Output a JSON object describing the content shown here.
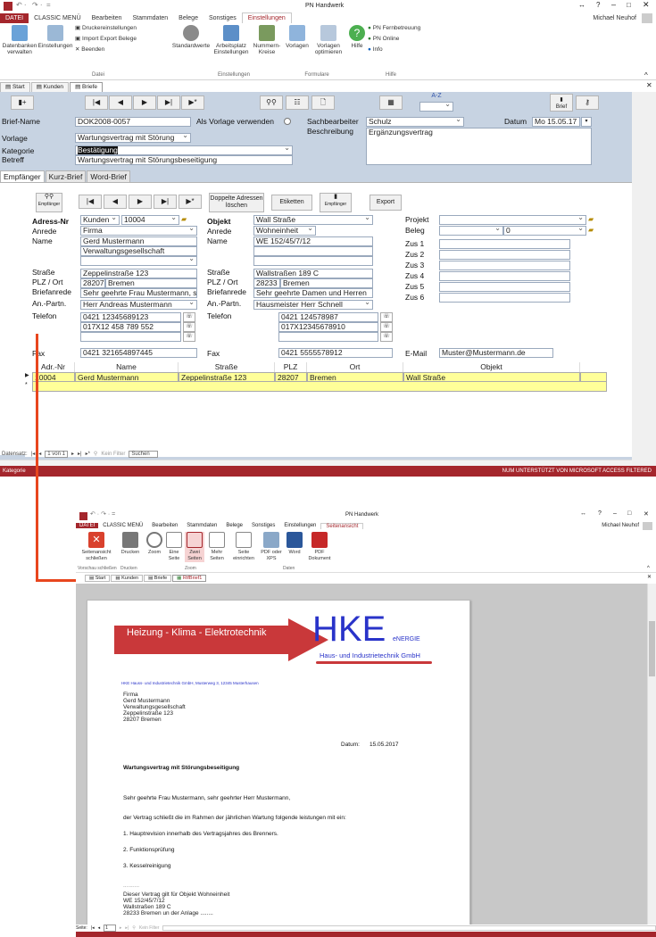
{
  "win1": {
    "title": "PN Handwerk",
    "user": "Michael Neuhof",
    "menu": [
      "DATEI",
      "CLASSIC MENÜ",
      "Bearbeiten",
      "Stammdaten",
      "Belege",
      "Sonstiges",
      "Einstellungen"
    ],
    "ribbon": {
      "datenbanken": "Datenbanken verwalten",
      "einstellungen": "Einstellungen",
      "druckereinstellungen": "Druckereinstellungen",
      "import_export": "Import Export Belege",
      "beenden": "Beenden",
      "standardwerte": "Standardwerte",
      "arbeitsplatz": "Arbeitsplatz Einstellungen",
      "nummernkreise": "Nummern- Kreise",
      "vorlagen": "Vorlagen",
      "vorlagen_opt": "Vorlagen optimieren",
      "hilfe": "Hilfe",
      "fernbetreuung": "PN Fernbetreuung",
      "online": "PN Online",
      "info": "Info",
      "grp_datei": "Datei",
      "grp_einstellungen": "Einstellungen",
      "grp_formulare": "Formulare",
      "grp_hilfe": "Hilfe"
    },
    "tabs": [
      "Start",
      "Kunden",
      "Briefe"
    ],
    "sort_label": "A-Z",
    "brief_label": "Brief",
    "header": {
      "briefname_lbl": "Brief-Name",
      "briefname": "DOK2008-0057",
      "vorlage_check_lbl": "Als Vorlage verwenden",
      "sachbearbeiter_lbl": "Sachbearbeiter",
      "sachbearbeiter": "Schulz",
      "datum_lbl": "Datum",
      "datum": "Mo 15.05.17",
      "beschreibung_lbl": "Beschreibung",
      "beschreibung": "Ergänzungsvertrag",
      "vorlage_lbl": "Vorlage",
      "vorlage": "Wartungsvertrag mit Störung",
      "kategorie_lbl": "Kategorie",
      "kategorie": "Bestätigung",
      "betreff_lbl": "Betreff",
      "betreff": "Wartungsvertrag mit Störungsbeseitigung"
    },
    "subtabs": [
      "Empfänger",
      "Kurz-Brief",
      "Word-Brief"
    ],
    "buttons": {
      "empfaenger": "Empfänger",
      "doppelte": "Doppelte Adressen löschen",
      "etiketten": "Etiketten",
      "export": "Export"
    },
    "adr": {
      "adrnr_lbl": "Adress-Nr",
      "adrtype": "Kunden",
      "adrnr": "10004",
      "anrede_lbl": "Anrede",
      "anrede": "Firma",
      "name_lbl": "Name",
      "name1": "Gerd Mustermann",
      "name2": "Verwaltungsgesellschaft",
      "strasse_lbl": "Straße",
      "strasse": "Zeppelinstraße 123",
      "plzort_lbl": "PLZ / Ort",
      "plz": "28207",
      "ort": "Bremen",
      "briefanrede_lbl": "Briefanrede",
      "briefanrede": "Sehr geehrte Frau Mustermann, s",
      "anpartn_lbl": "An.-Partn.",
      "anpartn": "Herr Andreas Mustermann",
      "telefon_lbl": "Telefon",
      "tel1": "0421 12345689123",
      "tel2": "017X12 458 789 552",
      "fax_lbl": "Fax",
      "fax": "0421 321654897445"
    },
    "obj": {
      "objekt_lbl": "Objekt",
      "objekt": "Wall Straße",
      "anrede_lbl": "Anrede",
      "anrede": "Wohneinheit",
      "name_lbl": "Name",
      "name1": "WE 152/45/7/12",
      "strasse_lbl": "Straße",
      "strasse": "Wallstraßen 189 C",
      "plzort_lbl": "PLZ / Ort",
      "plz": "28233",
      "ort": "Bremen",
      "briefanrede_lbl": "Briefanrede",
      "briefanrede": "Sehr geehrte Damen und Herren",
      "anpartn_lbl": "An.-Partn.",
      "anpartn": "Hausmeister Herr Schnell",
      "telefon_lbl": "Telefon",
      "tel1": "0421 124578987",
      "tel2": "017X12345678910",
      "fax_lbl": "Fax",
      "fax": "0421 5555578912"
    },
    "proj": {
      "projekt_lbl": "Projekt",
      "beleg_lbl": "Beleg",
      "beleg": "0",
      "zus": [
        "Zus 1",
        "Zus 2",
        "Zus 3",
        "Zus 4",
        "Zus 5",
        "Zus 6"
      ],
      "email_lbl": "E-Mail",
      "email": "Muster@Mustermann.de"
    },
    "grid": {
      "headers": [
        "Adr.-Nr",
        "Name",
        "Straße",
        "PLZ",
        "Ort",
        "Objekt"
      ],
      "row": [
        "10004",
        "Gerd Mustermann",
        "Zeppelinstraße 123",
        "28207",
        "Bremen",
        "Wall Straße"
      ]
    },
    "recordnav": {
      "label": "Datensatz:",
      "pos": "1 von 1",
      "filter": "Kein Filter",
      "search": "Suchen"
    },
    "status": {
      "left": "Kategorie",
      "right": "NUM    UNTERSTÜTZT VON MICROSOFT ACCESS    FILTERED"
    }
  },
  "win2": {
    "title": "PN Handwerk",
    "user": "Michael Neuhof",
    "menu": [
      "DATEI",
      "CLASSIC MENÜ",
      "Bearbeiten",
      "Stammdaten",
      "Belege",
      "Sonstiges",
      "Einstellungen",
      "Seitenansicht"
    ],
    "ribbon": {
      "schliessen": "Seitenansicht schließen",
      "drucken": "Drucken",
      "zoom": "Zoom",
      "eine_seite": "Eine Seite",
      "zwei_seiten": "Zwei Seiten",
      "mehr_seiten": "Mehr Seiten",
      "seite_einrichten": "Seite einrichten",
      "pdf_xps": "PDF oder XPS",
      "word": "Word",
      "pdf_dok": "PDF Dokument",
      "grp_vorschau": "Vorschau schließen",
      "grp_drucken": "Drucken",
      "grp_zoom": "Zoom",
      "grp_daten": "Daten"
    },
    "tabs": [
      "Start",
      "Kunden",
      "Briefe",
      "RtfBrief1"
    ],
    "letter": {
      "banner": "Heizung - Klima - Elektrotechnik",
      "logo": "HKE",
      "logo_sub": "eNERGIE",
      "logo_line": "Haus- und Industrietechnik GmbH",
      "sender": "HKE Hauss- und Industrietechnik GmbH, Musterweg 3, 12345 Musterhausen",
      "addr": [
        "Firma",
        "Gerd Mustermann",
        "Verwaltungsgesellschaft",
        "Zeppelinstraße 123",
        "28207 Bremen"
      ],
      "datum_lbl": "Datum:",
      "datum": "15.05.2017",
      "subject": "Wartungsvertrag mit Störungsbeseitigung",
      "greeting": "Sehr geehrte Frau Mustermann, sehr geehrter Herr Mustermann,",
      "intro": "der Vertrag schließt die im Rahmen der jährlichen Wartung folgende leistungen mit ein:",
      "items": [
        "1. Hauptrevision innerhalb des Vertragsjahres des Brenners.",
        "2. Funktionsprüfung",
        "3. Kesselreinigung"
      ],
      "dots": "..........",
      "obj": [
        "Dieser Vertrag gilt für Objekt Wohneinheit",
        "WE 152/45/7/12",
        "Wallstraßen 189 C",
        "28233 Bremen un der Anlage  ........"
      ]
    },
    "pagenav": {
      "label": "Seite:",
      "page": "1",
      "filter": "Kein Filter"
    }
  }
}
